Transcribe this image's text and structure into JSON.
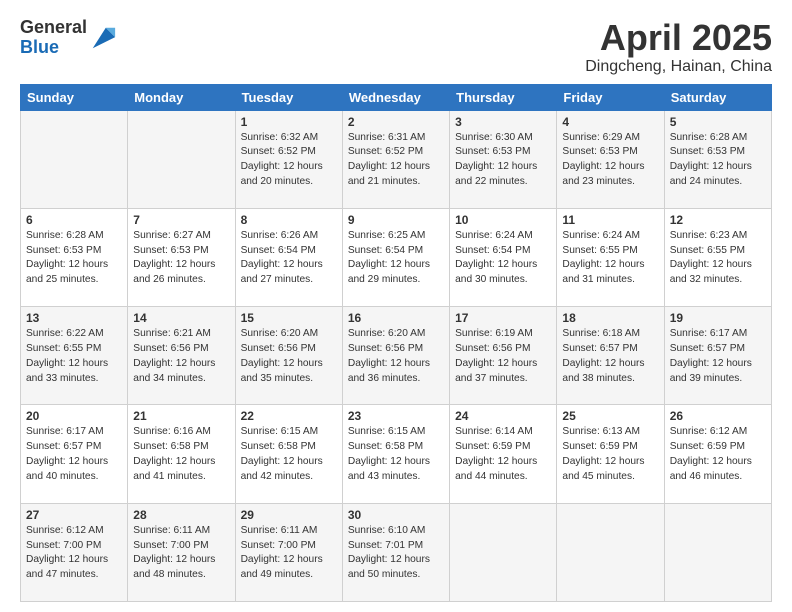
{
  "header": {
    "logo_line1": "General",
    "logo_line2": "Blue",
    "month": "April 2025",
    "location": "Dingcheng, Hainan, China"
  },
  "weekdays": [
    "Sunday",
    "Monday",
    "Tuesday",
    "Wednesday",
    "Thursday",
    "Friday",
    "Saturday"
  ],
  "weeks": [
    [
      {
        "day": "",
        "info": ""
      },
      {
        "day": "",
        "info": ""
      },
      {
        "day": "1",
        "info": "Sunrise: 6:32 AM\nSunset: 6:52 PM\nDaylight: 12 hours and 20 minutes."
      },
      {
        "day": "2",
        "info": "Sunrise: 6:31 AM\nSunset: 6:52 PM\nDaylight: 12 hours and 21 minutes."
      },
      {
        "day": "3",
        "info": "Sunrise: 6:30 AM\nSunset: 6:53 PM\nDaylight: 12 hours and 22 minutes."
      },
      {
        "day": "4",
        "info": "Sunrise: 6:29 AM\nSunset: 6:53 PM\nDaylight: 12 hours and 23 minutes."
      },
      {
        "day": "5",
        "info": "Sunrise: 6:28 AM\nSunset: 6:53 PM\nDaylight: 12 hours and 24 minutes."
      }
    ],
    [
      {
        "day": "6",
        "info": "Sunrise: 6:28 AM\nSunset: 6:53 PM\nDaylight: 12 hours and 25 minutes."
      },
      {
        "day": "7",
        "info": "Sunrise: 6:27 AM\nSunset: 6:53 PM\nDaylight: 12 hours and 26 minutes."
      },
      {
        "day": "8",
        "info": "Sunrise: 6:26 AM\nSunset: 6:54 PM\nDaylight: 12 hours and 27 minutes."
      },
      {
        "day": "9",
        "info": "Sunrise: 6:25 AM\nSunset: 6:54 PM\nDaylight: 12 hours and 29 minutes."
      },
      {
        "day": "10",
        "info": "Sunrise: 6:24 AM\nSunset: 6:54 PM\nDaylight: 12 hours and 30 minutes."
      },
      {
        "day": "11",
        "info": "Sunrise: 6:24 AM\nSunset: 6:55 PM\nDaylight: 12 hours and 31 minutes."
      },
      {
        "day": "12",
        "info": "Sunrise: 6:23 AM\nSunset: 6:55 PM\nDaylight: 12 hours and 32 minutes."
      }
    ],
    [
      {
        "day": "13",
        "info": "Sunrise: 6:22 AM\nSunset: 6:55 PM\nDaylight: 12 hours and 33 minutes."
      },
      {
        "day": "14",
        "info": "Sunrise: 6:21 AM\nSunset: 6:56 PM\nDaylight: 12 hours and 34 minutes."
      },
      {
        "day": "15",
        "info": "Sunrise: 6:20 AM\nSunset: 6:56 PM\nDaylight: 12 hours and 35 minutes."
      },
      {
        "day": "16",
        "info": "Sunrise: 6:20 AM\nSunset: 6:56 PM\nDaylight: 12 hours and 36 minutes."
      },
      {
        "day": "17",
        "info": "Sunrise: 6:19 AM\nSunset: 6:56 PM\nDaylight: 12 hours and 37 minutes."
      },
      {
        "day": "18",
        "info": "Sunrise: 6:18 AM\nSunset: 6:57 PM\nDaylight: 12 hours and 38 minutes."
      },
      {
        "day": "19",
        "info": "Sunrise: 6:17 AM\nSunset: 6:57 PM\nDaylight: 12 hours and 39 minutes."
      }
    ],
    [
      {
        "day": "20",
        "info": "Sunrise: 6:17 AM\nSunset: 6:57 PM\nDaylight: 12 hours and 40 minutes."
      },
      {
        "day": "21",
        "info": "Sunrise: 6:16 AM\nSunset: 6:58 PM\nDaylight: 12 hours and 41 minutes."
      },
      {
        "day": "22",
        "info": "Sunrise: 6:15 AM\nSunset: 6:58 PM\nDaylight: 12 hours and 42 minutes."
      },
      {
        "day": "23",
        "info": "Sunrise: 6:15 AM\nSunset: 6:58 PM\nDaylight: 12 hours and 43 minutes."
      },
      {
        "day": "24",
        "info": "Sunrise: 6:14 AM\nSunset: 6:59 PM\nDaylight: 12 hours and 44 minutes."
      },
      {
        "day": "25",
        "info": "Sunrise: 6:13 AM\nSunset: 6:59 PM\nDaylight: 12 hours and 45 minutes."
      },
      {
        "day": "26",
        "info": "Sunrise: 6:12 AM\nSunset: 6:59 PM\nDaylight: 12 hours and 46 minutes."
      }
    ],
    [
      {
        "day": "27",
        "info": "Sunrise: 6:12 AM\nSunset: 7:00 PM\nDaylight: 12 hours and 47 minutes."
      },
      {
        "day": "28",
        "info": "Sunrise: 6:11 AM\nSunset: 7:00 PM\nDaylight: 12 hours and 48 minutes."
      },
      {
        "day": "29",
        "info": "Sunrise: 6:11 AM\nSunset: 7:00 PM\nDaylight: 12 hours and 49 minutes."
      },
      {
        "day": "30",
        "info": "Sunrise: 6:10 AM\nSunset: 7:01 PM\nDaylight: 12 hours and 50 minutes."
      },
      {
        "day": "",
        "info": ""
      },
      {
        "day": "",
        "info": ""
      },
      {
        "day": "",
        "info": ""
      }
    ]
  ]
}
